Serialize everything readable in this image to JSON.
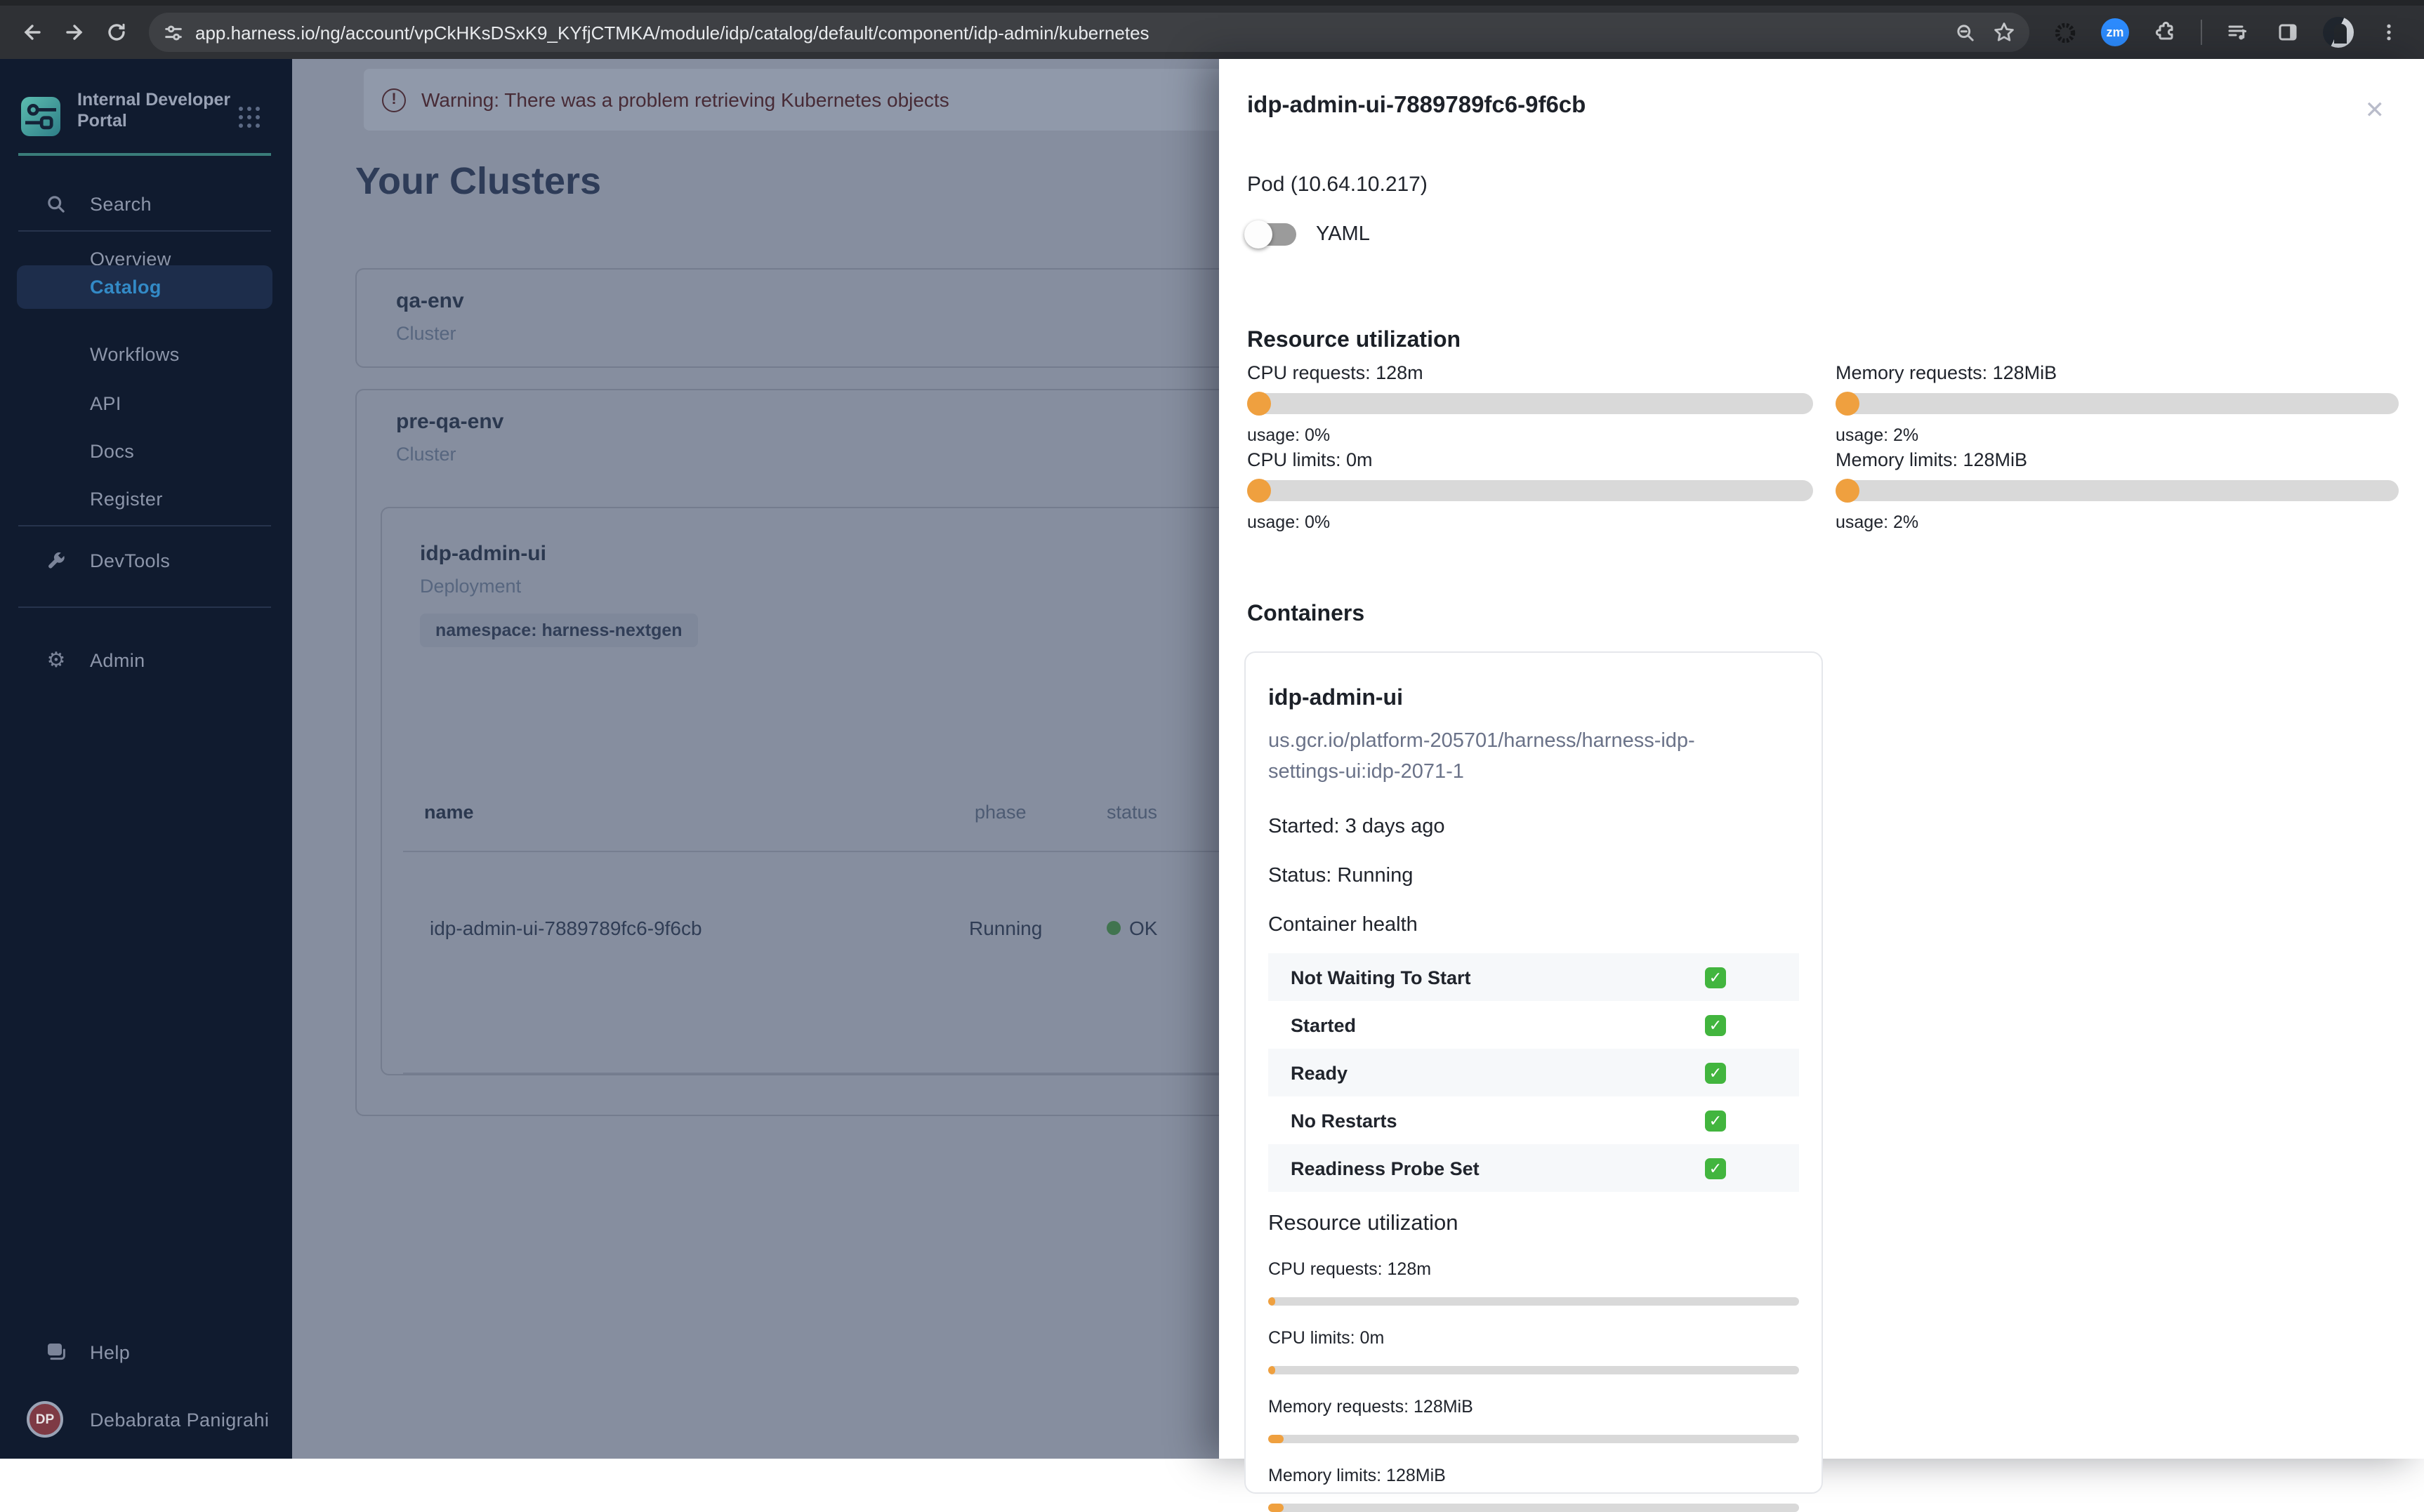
{
  "browser": {
    "url": "app.harness.io/ng/account/vpCkHKsDSxK9_KYfjCTMKA/module/idp/catalog/default/component/idp-admin/kubernetes",
    "zoom_app_label": "zm"
  },
  "sidebar": {
    "product_title": "Internal Developer Portal",
    "items": [
      {
        "label": "Search"
      },
      {
        "label": "Overview"
      },
      {
        "label": "Catalog",
        "active": true
      },
      {
        "label": "Workflows"
      },
      {
        "label": "API"
      },
      {
        "label": "Docs"
      },
      {
        "label": "Register"
      },
      {
        "label": "DevTools"
      },
      {
        "label": "Admin"
      }
    ],
    "help_label": "Help",
    "user": {
      "initials": "DP",
      "name": "Debabrata Panigrahi"
    }
  },
  "main": {
    "warning_banner": "Warning: There was a problem retrieving Kubernetes objects",
    "page_title": "Your Clusters",
    "clusters": [
      {
        "name": "qa-env",
        "kind": "Cluster"
      },
      {
        "name": "pre-qa-env",
        "kind": "Cluster"
      }
    ],
    "deployment": {
      "name": "idp-admin-ui",
      "kind": "Deployment",
      "namespace_chip": "namespace: harness-nextgen",
      "table": {
        "columns": [
          "name",
          "phase",
          "status"
        ],
        "rows": [
          {
            "name": "idp-admin-ui-7889789fc6-9f6cb",
            "phase": "Running",
            "status": "OK"
          }
        ]
      }
    }
  },
  "drawer": {
    "title": "idp-admin-ui-7889789fc6-9f6cb",
    "subtitle": "Pod (10.64.10.217)",
    "yaml_toggle_label": "YAML",
    "yaml_toggle_on": false,
    "resource": {
      "heading": "Resource utilization",
      "metrics": [
        {
          "label": "CPU requests: 128m",
          "usage": "usage: 0%"
        },
        {
          "label": "Memory requests: 128MiB",
          "usage": "usage: 2%"
        },
        {
          "label": "CPU limits: 0m",
          "usage": "usage: 0%"
        },
        {
          "label": "Memory limits: 128MiB",
          "usage": "usage: 2%"
        }
      ]
    },
    "containers": {
      "heading": "Containers",
      "card": {
        "name": "idp-admin-ui",
        "image_line1": "us.gcr.io/platform-205701/harness/harness-idp-",
        "image_line2": "settings-ui:idp-2071-1",
        "started": "Started: 3 days ago",
        "status": "Status: Running",
        "health_heading": "Container health",
        "health": [
          {
            "label": "Not Waiting To Start"
          },
          {
            "label": "Started"
          },
          {
            "label": "Ready"
          },
          {
            "label": "No Restarts"
          },
          {
            "label": "Readiness Probe Set"
          }
        ],
        "resource_heading": "Resource utilization",
        "metrics": [
          {
            "label": "CPU requests: 128m",
            "fill_pct": 1.2
          },
          {
            "label": "CPU limits: 0m",
            "fill_pct": 1.2
          },
          {
            "label": "Memory requests: 128MiB",
            "fill_pct": 3.0
          },
          {
            "label": "Memory limits: 128MiB",
            "fill_pct": 3.0
          }
        ]
      }
    }
  },
  "colors": {
    "accent_orange": "#efa03f",
    "check_green": "#42b53e",
    "status_ok_green": "#41744f",
    "sidebar_bg": "#101b2f",
    "active_item_blue": "#338ac6",
    "toolbar_bg": "#2f3135"
  }
}
